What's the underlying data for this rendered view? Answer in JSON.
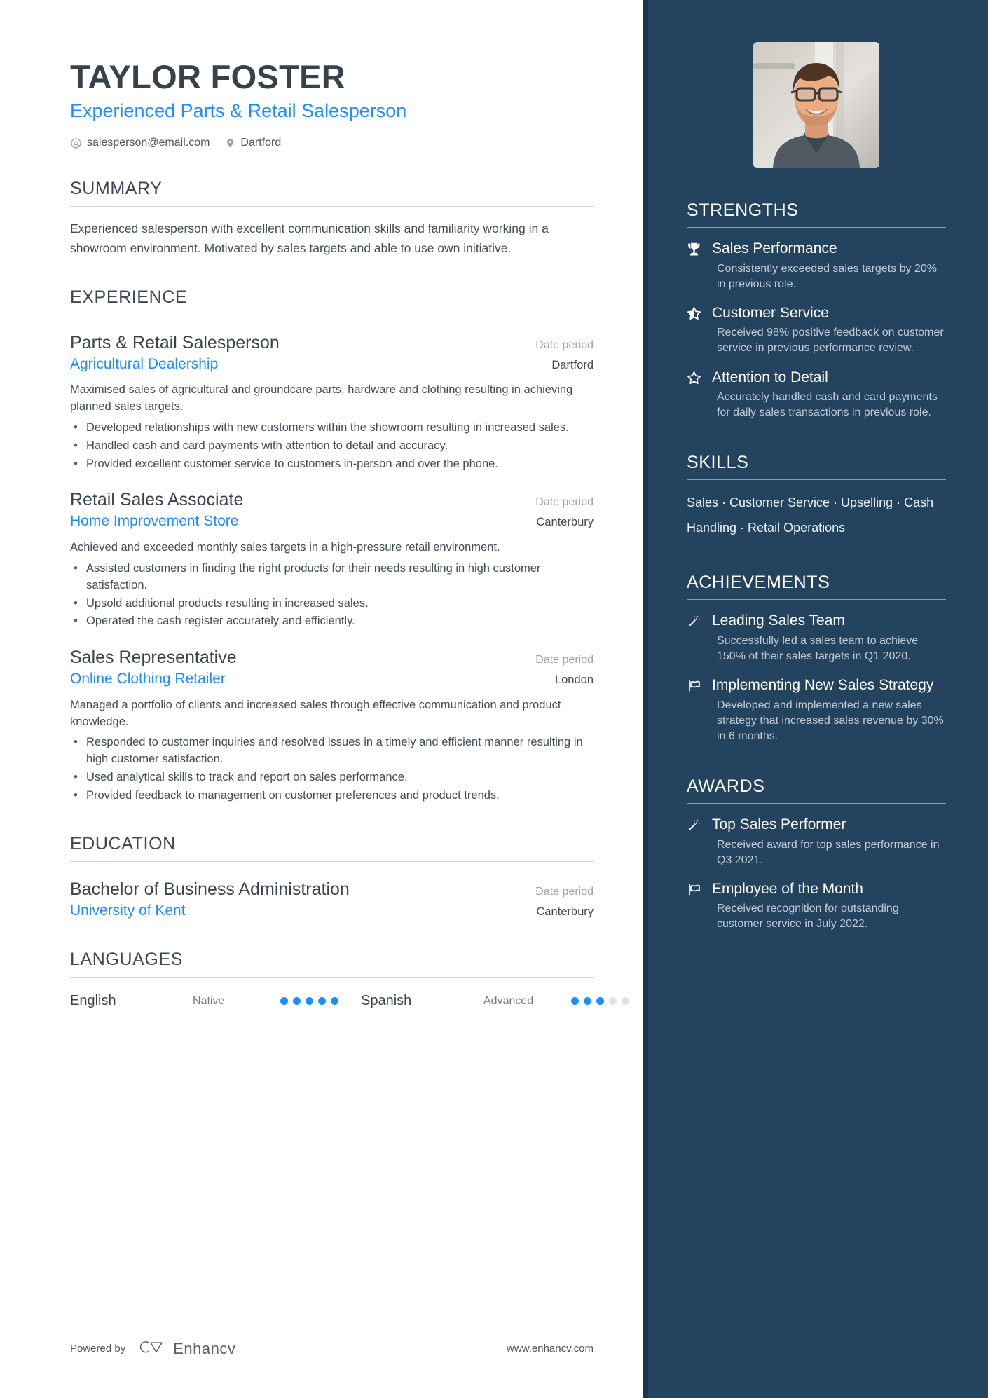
{
  "header": {
    "name": "TAYLOR FOSTER",
    "headline": "Experienced Parts & Retail Salesperson",
    "email": "salesperson@email.com",
    "location": "Dartford"
  },
  "summary": {
    "title": "SUMMARY",
    "text": "Experienced salesperson with excellent communication skills and familiarity working in a showroom environment. Motivated by sales targets and able to use own initiative."
  },
  "experience": {
    "title": "EXPERIENCE",
    "entries": [
      {
        "role": "Parts & Retail Salesperson",
        "date": "Date period",
        "org": "Agricultural Dealership",
        "location": "Dartford",
        "description": "Maximised sales of agricultural and groundcare parts, hardware and clothing resulting in achieving planned sales targets.",
        "bullets": [
          "Developed relationships with new customers within the showroom resulting in increased sales.",
          "Handled cash and card payments with attention to detail and accuracy.",
          "Provided excellent customer service to customers in-person and over the phone."
        ]
      },
      {
        "role": "Retail Sales Associate",
        "date": "Date period",
        "org": "Home Improvement Store",
        "location": "Canterbury",
        "description": "Achieved and exceeded monthly sales targets in a high-pressure retail environment.",
        "bullets": [
          "Assisted customers in finding the right products for their needs resulting in high customer satisfaction.",
          "Upsold additional products resulting in increased sales.",
          "Operated the cash register accurately and efficiently."
        ]
      },
      {
        "role": "Sales Representative",
        "date": "Date period",
        "org": "Online Clothing Retailer",
        "location": "London",
        "description": "Managed a portfolio of clients and increased sales through effective communication and product knowledge.",
        "bullets": [
          "Responded to customer inquiries and resolved issues in a timely and efficient manner resulting in high customer satisfaction.",
          "Used analytical skills to track and report on sales performance.",
          "Provided feedback to management on customer preferences and product trends."
        ]
      }
    ]
  },
  "education": {
    "title": "EDUCATION",
    "entries": [
      {
        "degree": "Bachelor of Business Administration",
        "date": "Date period",
        "school": "University of Kent",
        "location": "Canterbury"
      }
    ]
  },
  "languages": {
    "title": "LANGUAGES",
    "items": [
      {
        "name": "English",
        "level": "Native",
        "filled": 5,
        "total": 5
      },
      {
        "name": "Spanish",
        "level": "Advanced",
        "filled": 3,
        "total": 5
      }
    ]
  },
  "footer": {
    "powered_by": "Powered by",
    "brand": "Enhancv",
    "website": "www.enhancv.com"
  },
  "sidebar": {
    "strengths": {
      "title": "STRENGTHS",
      "items": [
        {
          "icon": "trophy-icon",
          "title": "Sales Performance",
          "desc": "Consistently exceeded sales targets by 20% in previous role."
        },
        {
          "icon": "half-star-icon",
          "title": "Customer Service",
          "desc": "Received 98% positive feedback on customer service in previous performance review."
        },
        {
          "icon": "star-outline-icon",
          "title": "Attention to Detail",
          "desc": "Accurately handled cash and card payments for daily sales transactions in previous role."
        }
      ]
    },
    "skills": {
      "title": "SKILLS",
      "text": "Sales · Customer Service · Upselling · Cash Handling · Retail Operations",
      "list": [
        "Sales",
        "Customer Service",
        "Upselling",
        "Cash Handling",
        "Retail Operations"
      ]
    },
    "achievements": {
      "title": "ACHIEVEMENTS",
      "items": [
        {
          "icon": "magic-wand-icon",
          "title": "Leading Sales Team",
          "desc": "Successfully led a sales team to achieve 150% of their sales targets in Q1 2020."
        },
        {
          "icon": "flag-icon",
          "title": "Implementing New Sales Strategy",
          "desc": "Developed and implemented a new sales strategy that increased sales revenue by 30% in 6 months."
        }
      ]
    },
    "awards": {
      "title": "AWARDS",
      "items": [
        {
          "icon": "magic-wand-icon",
          "title": "Top Sales Performer",
          "desc": "Received award for top sales performance in Q3 2021."
        },
        {
          "icon": "flag-icon",
          "title": "Employee of the Month",
          "desc": "Received recognition for outstanding customer service in July 2022."
        }
      ]
    }
  },
  "colors": {
    "accent_blue": "#1d8dff",
    "sidebar_bg": "#24435f",
    "sidebar_edge": "#1d3349",
    "text_dark": "#3a444e",
    "muted": "#9aa2a9"
  }
}
